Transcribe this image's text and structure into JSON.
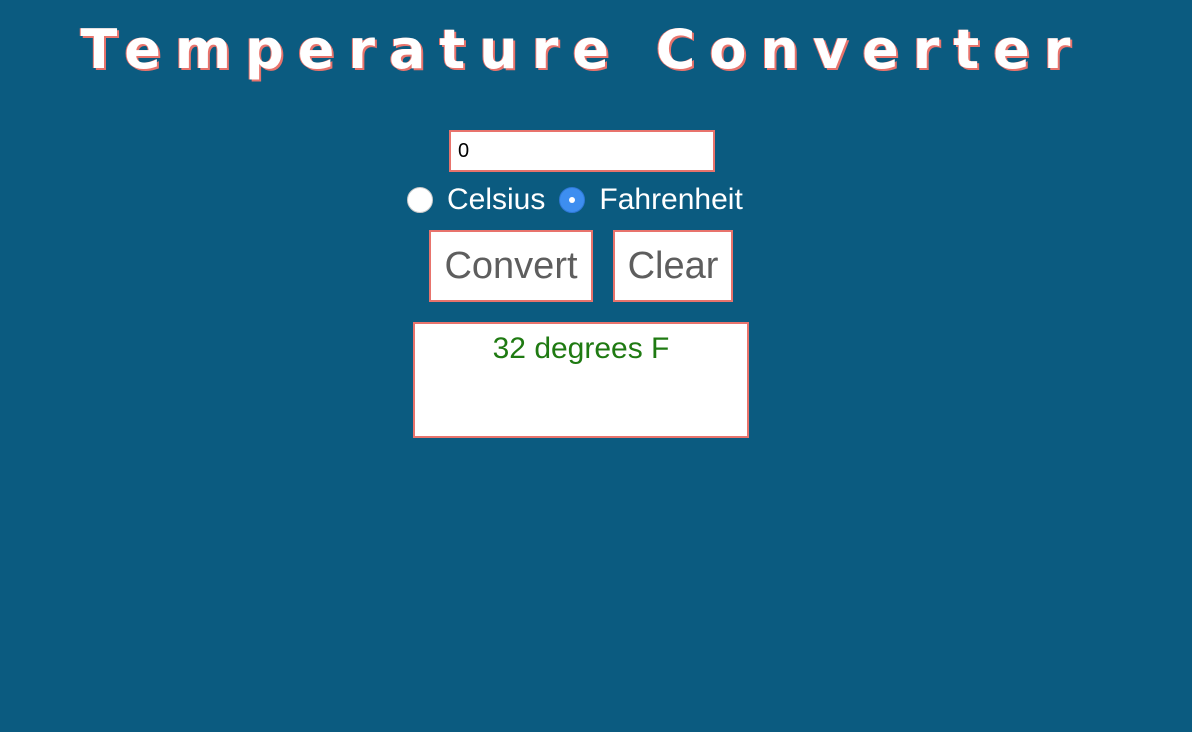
{
  "header": {
    "title": "Temperature Converter"
  },
  "form": {
    "temperature_value": "0",
    "units": {
      "celsius_label": "Celsius",
      "fahrenheit_label": "Fahrenheit",
      "selected": "Fahrenheit"
    },
    "convert_label": "Convert",
    "clear_label": "Clear"
  },
  "result": {
    "text": "32 degrees F"
  },
  "colors": {
    "background": "#0b5b80",
    "accent_border": "#e8736c",
    "result_text": "#1f7a12",
    "radio_selected": "#3d8ef0"
  }
}
